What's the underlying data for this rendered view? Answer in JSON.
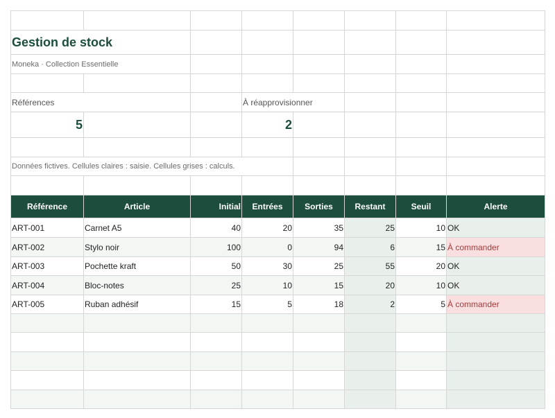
{
  "sheet": {
    "title": "Gestion de stock",
    "subtitle": "Moneka · Collection Essentielle",
    "note": "Données fictives. Cellules claires : saisie. Cellules grises : calculs.",
    "kpis": [
      {
        "label": "Références",
        "value": "5"
      },
      {
        "label": "À réapprovisionner",
        "value": "2"
      }
    ]
  },
  "table": {
    "headers": [
      "Référence",
      "Article",
      "Initial",
      "Entrées",
      "Sorties",
      "Restant",
      "Seuil",
      "Alerte"
    ],
    "rows": [
      {
        "ref": "ART-001",
        "article": "Carnet A5",
        "initial": "40",
        "entrees": "20",
        "sorties": "35",
        "restant": "25",
        "seuil": "10",
        "alerte": "OK"
      },
      {
        "ref": "ART-002",
        "article": "Stylo noir",
        "initial": "100",
        "entrees": "0",
        "sorties": "94",
        "restant": "6",
        "seuil": "15",
        "alerte": "À commander"
      },
      {
        "ref": "ART-003",
        "article": "Pochette kraft",
        "initial": "50",
        "entrees": "30",
        "sorties": "25",
        "restant": "55",
        "seuil": "20",
        "alerte": "OK"
      },
      {
        "ref": "ART-004",
        "article": "Bloc-notes",
        "initial": "25",
        "entrees": "10",
        "sorties": "15",
        "restant": "20",
        "seuil": "10",
        "alerte": "OK"
      },
      {
        "ref": "ART-005",
        "article": "Ruban adhésif",
        "initial": "15",
        "entrees": "5",
        "sorties": "18",
        "restant": "2",
        "seuil": "5",
        "alerte": "À commander"
      }
    ]
  },
  "colors": {
    "header_bg": "#1c4d3d",
    "accent_text": "#1c4d3d",
    "calc_bg": "#e9f0eb",
    "alert_bg": "#f9dfdf",
    "alert_text": "#a33b3b",
    "stripe_bg": "#f3f7f4",
    "grid": "#d6d6d6"
  }
}
